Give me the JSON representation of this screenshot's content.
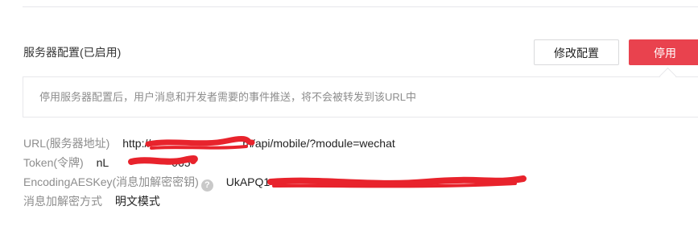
{
  "section": {
    "title": "服务器配置(已启用)",
    "modify_button": "修改配置",
    "disable_button": "停用"
  },
  "tip": {
    "text": "停用服务器配置后，用户消息和开发者需要的事件推送，将不会被转发到该URL中"
  },
  "fields": {
    "url": {
      "label": "URL(服务器地址)",
      "value_prefix": "http://",
      "value_suffix": "m/api/mobile/?module=wechat"
    },
    "token": {
      "label": "Token(令牌)",
      "value_prefix": "nL",
      "value_suffix": "065"
    },
    "aes_key": {
      "label": "EncodingAESKey(消息加解密密钥)",
      "help_icon": "question-icon",
      "value_prefix": "UkAPQ1"
    },
    "encrypt_mode": {
      "label": "消息加解密方式",
      "value": "明文模式"
    }
  },
  "colors": {
    "danger": "#e9424e",
    "redaction": "#e8232c",
    "label_gray": "#8d8d8d",
    "border": "#e7e7eb"
  }
}
